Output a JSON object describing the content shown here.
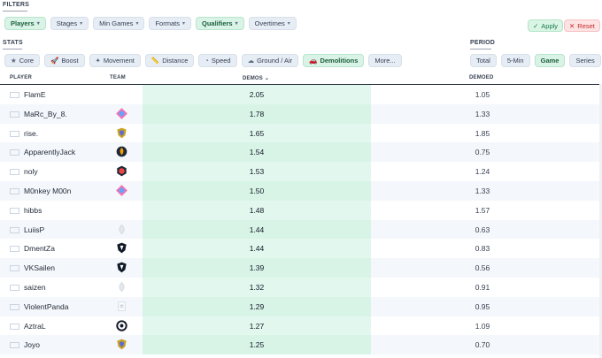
{
  "filters": {
    "label": "FILTERS",
    "chips": [
      {
        "label": "Players",
        "active": true
      },
      {
        "label": "Stages",
        "active": false
      },
      {
        "label": "Min Games",
        "active": false
      },
      {
        "label": "Formats",
        "active": false
      },
      {
        "label": "Qualifiers",
        "active": true
      },
      {
        "label": "Overtimes",
        "active": false
      }
    ],
    "apply_label": "Apply",
    "reset_label": "Reset"
  },
  "stats": {
    "label": "STATS",
    "chips": [
      {
        "label": "Core",
        "icon": "star-icon",
        "active": false
      },
      {
        "label": "Boost",
        "icon": "rocket-icon",
        "active": false
      },
      {
        "label": "Movement",
        "icon": "runner-icon",
        "active": false
      },
      {
        "label": "Distance",
        "icon": "ruler-icon",
        "active": false
      },
      {
        "label": "Speed",
        "icon": "gauge-icon",
        "active": false
      },
      {
        "label": "Ground / Air",
        "icon": "cloud-icon",
        "active": false
      },
      {
        "label": "Demolitions",
        "icon": "car-icon",
        "active": true
      },
      {
        "label": "More...",
        "icon": "",
        "active": false
      }
    ]
  },
  "period": {
    "label": "PERIOD",
    "chips": [
      {
        "label": "Total",
        "active": false
      },
      {
        "label": "5-Min",
        "active": false
      },
      {
        "label": "Game",
        "active": true
      },
      {
        "label": "Series",
        "active": false
      }
    ]
  },
  "table": {
    "headers": {
      "player": "PLAYER",
      "team": "TEAM",
      "demos": "DEMOS ⌄",
      "demoed": "DEMOED"
    },
    "rows": [
      {
        "name": "FlamE",
        "flag": "england",
        "team_logo": "none",
        "demos": "2.05",
        "demoed": "1.05"
      },
      {
        "name": "MaRc_By_8.",
        "flag": "spain",
        "team_logo": "pink-diamond-logo",
        "demos": "1.78",
        "demoed": "1.33"
      },
      {
        "name": "rise.",
        "flag": "england",
        "team_logo": "gold-shield-logo",
        "demos": "1.65",
        "demoed": "1.85"
      },
      {
        "name": "ApparentlyJack",
        "flag": "england",
        "team_logo": "orange-flame-logo",
        "demos": "1.54",
        "demoed": "0.75"
      },
      {
        "name": "noly",
        "flag": "england",
        "team_logo": "red-badge-logo",
        "demos": "1.53",
        "demoed": "1.24"
      },
      {
        "name": "M0nkey M00n",
        "flag": "france",
        "team_logo": "pink-diamond-logo",
        "demos": "1.50",
        "demoed": "1.33"
      },
      {
        "name": "hibbs",
        "flag": "england",
        "team_logo": "none",
        "demos": "1.48",
        "demoed": "1.57"
      },
      {
        "name": "LuiisP",
        "flag": "spain",
        "team_logo": "gray-flame-logo",
        "demos": "1.44",
        "demoed": "0.63"
      },
      {
        "name": "DmentZa",
        "flag": "spain",
        "team_logo": "black-shield-logo",
        "demos": "1.44",
        "demoed": "0.83"
      },
      {
        "name": "VKSailen",
        "flag": "spain",
        "team_logo": "black-shield-logo",
        "demos": "1.39",
        "demoed": "0.56"
      },
      {
        "name": "saizen",
        "flag": "france",
        "team_logo": "gray-flame-logo",
        "demos": "1.32",
        "demoed": "0.91"
      },
      {
        "name": "ViolentPanda",
        "flag": "netherlands",
        "team_logo": "white-card-logo",
        "demos": "1.29",
        "demoed": "0.95"
      },
      {
        "name": "AztraL",
        "flag": "belgium",
        "team_logo": "black-swirl-logo",
        "demos": "1.27",
        "demoed": "1.09"
      },
      {
        "name": "Joyo",
        "flag": "england",
        "team_logo": "gold-shield-logo",
        "demos": "1.25",
        "demoed": "0.70"
      }
    ]
  },
  "colors": {
    "active_chip": "#d9f3e6",
    "demos_column": "#e2f8ee",
    "apply": "#16794a",
    "reset": "#c42b2b"
  }
}
